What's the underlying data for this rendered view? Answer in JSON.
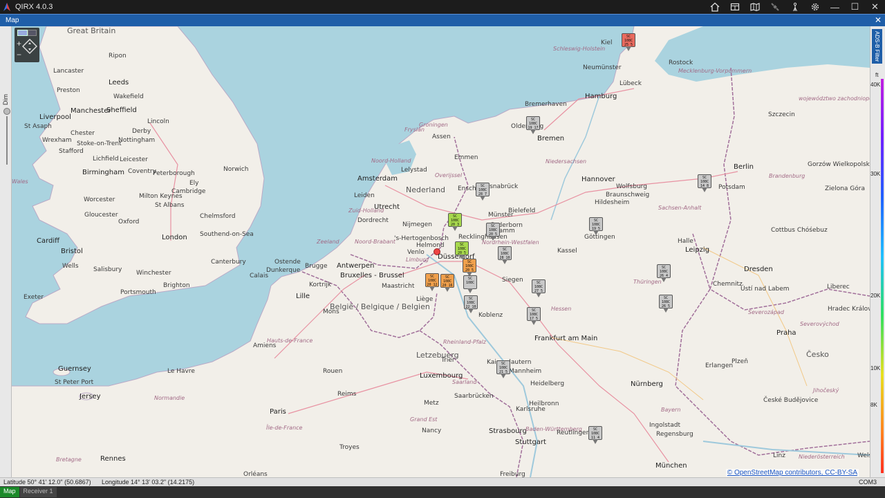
{
  "app": {
    "title": "QIRX 4.0.3",
    "titlebar_icons": [
      "home-icon",
      "layout-icon",
      "book-icon",
      "satellite-icon",
      "antenna-icon",
      "gear-icon"
    ],
    "window_controls": {
      "minimize": "—",
      "maximize": "☐",
      "close": "✕"
    }
  },
  "panel": {
    "title": "Map",
    "close": "✕"
  },
  "left_bar": {
    "label": "Dim"
  },
  "right_bar": {
    "filter_tab": "ADS-B Filter",
    "unit": "ft",
    "ticks": [
      "40K",
      "30K",
      "20K",
      "10K",
      "8K"
    ]
  },
  "map": {
    "labels": [
      {
        "t": "Great Britain",
        "c": "country"
      },
      {
        "t": "Ripon"
      },
      {
        "t": "Leeds",
        "c": "big"
      },
      {
        "t": "Lancaster"
      },
      {
        "t": "Preston"
      },
      {
        "t": "Wakefield"
      },
      {
        "t": "Manchester",
        "c": "big"
      },
      {
        "t": "Sheffield",
        "c": "big"
      },
      {
        "t": "Liverpool",
        "c": "big"
      },
      {
        "t": "St Asaph"
      },
      {
        "t": "Chester"
      },
      {
        "t": "Wrexham"
      },
      {
        "t": "Stoke-on-Trent"
      },
      {
        "t": "Derby"
      },
      {
        "t": "Nottingham"
      },
      {
        "t": "Lincoln"
      },
      {
        "t": "Stafford"
      },
      {
        "t": "Lichfield"
      },
      {
        "t": "Leicester"
      },
      {
        "t": "Birmingham",
        "c": "big"
      },
      {
        "t": "Coventry"
      },
      {
        "t": "Peterborough"
      },
      {
        "t": "Ely"
      },
      {
        "t": "Norwich"
      },
      {
        "t": "Cambridge"
      },
      {
        "t": "Worcester"
      },
      {
        "t": "Milton Keynes"
      },
      {
        "t": "Gloucester"
      },
      {
        "t": "Oxford"
      },
      {
        "t": "St Albans"
      },
      {
        "t": "Chelmsford"
      },
      {
        "t": "Southend-on-Sea"
      },
      {
        "t": "London",
        "c": "big"
      },
      {
        "t": "Cardiff",
        "c": "big"
      },
      {
        "t": "Bristol",
        "c": "big"
      },
      {
        "t": "Wells"
      },
      {
        "t": "Salisbury"
      },
      {
        "t": "Winchester"
      },
      {
        "t": "Canterbury"
      },
      {
        "t": "Brighton"
      },
      {
        "t": "Portsmouth"
      },
      {
        "t": "Exeter"
      },
      {
        "t": "Wales",
        "c": "region"
      },
      {
        "t": "Guernsey",
        "c": "big"
      },
      {
        "t": "St Peter Port"
      },
      {
        "t": "Jersey",
        "c": "big"
      },
      {
        "t": "Kiel"
      },
      {
        "t": "Schleswig-Holstein",
        "c": "region"
      },
      {
        "t": "Neumünster"
      },
      {
        "t": "Rostock"
      },
      {
        "t": "Mecklenburg-Vorpommern",
        "c": "region"
      },
      {
        "t": "Lübeck"
      },
      {
        "t": "Hamburg",
        "c": "big"
      },
      {
        "t": "Bremerhaven"
      },
      {
        "t": "Oldenburg"
      },
      {
        "t": "Bremen",
        "c": "big"
      },
      {
        "t": "Szczecin"
      },
      {
        "t": "województwo zachodniopomorskie",
        "c": "region"
      },
      {
        "t": "Gorzów Wielkopolski"
      },
      {
        "t": "Berlin",
        "c": "big"
      },
      {
        "t": "Potsdam"
      },
      {
        "t": "Brandenburg",
        "c": "region"
      },
      {
        "t": "Zielona Góra"
      },
      {
        "t": "Hannover",
        "c": "big"
      },
      {
        "t": "Wolfsburg"
      },
      {
        "t": "Braunschweig"
      },
      {
        "t": "Hildesheim"
      },
      {
        "t": "Niedersachsen",
        "c": "region"
      },
      {
        "t": "Sachsen-Anhalt",
        "c": "region"
      },
      {
        "t": "Cottbus Chóśebuz"
      },
      {
        "t": "Groningen",
        "c": "region"
      },
      {
        "t": "Assen"
      },
      {
        "t": "Emmen"
      },
      {
        "t": "Fryslân",
        "c": "region"
      },
      {
        "t": "Noord-Holland",
        "c": "region"
      },
      {
        "t": "Lelystad"
      },
      {
        "t": "Amsterdam",
        "c": "big"
      },
      {
        "t": "Nederland",
        "c": "country"
      },
      {
        "t": "Overijssel",
        "c": "region"
      },
      {
        "t": "Enschede"
      },
      {
        "t": "Osnabrück"
      },
      {
        "t": "Leiden"
      },
      {
        "t": "Utrecht",
        "c": "big"
      },
      {
        "t": "Zuid-Holland",
        "c": "region"
      },
      {
        "t": "Dordrecht"
      },
      {
        "t": "Nijmegen"
      },
      {
        "t": "Münster"
      },
      {
        "t": "Bielefeld"
      },
      {
        "t": "Paderborn"
      },
      {
        "t": "Hamm"
      },
      {
        "t": "Göttingen"
      },
      {
        "t": "Halle"
      },
      {
        "t": "Leipzig",
        "c": "big"
      },
      {
        "t": "Zeeland",
        "c": "region"
      },
      {
        "t": "Noord-Brabant",
        "c": "region"
      },
      {
        "t": "'s-Hertogenbosch"
      },
      {
        "t": "Recklinghausen"
      },
      {
        "t": "Helmond"
      },
      {
        "t": "Venlo"
      },
      {
        "t": "Limburg",
        "c": "region"
      },
      {
        "t": "Nordrhein-Westfalen",
        "c": "region"
      },
      {
        "t": "Düsseldorf",
        "c": "big"
      },
      {
        "t": "Kassel"
      },
      {
        "t": "Dresden",
        "c": "big"
      },
      {
        "t": "Ostende"
      },
      {
        "t": "Brugge"
      },
      {
        "t": "Antwerpen",
        "c": "big"
      },
      {
        "t": "Bruxelles - Brussel",
        "c": "big"
      },
      {
        "t": "Dunkerque"
      },
      {
        "t": "Calais"
      },
      {
        "t": "Kortrijk"
      },
      {
        "t": "Maastricht"
      },
      {
        "t": "Liège"
      },
      {
        "t": "Siegen"
      },
      {
        "t": "Thüringen",
        "c": "region"
      },
      {
        "t": "Chemnitz"
      },
      {
        "t": "Ústí nad Labem"
      },
      {
        "t": "Liberec"
      },
      {
        "t": "Lille",
        "c": "big"
      },
      {
        "t": "België / Belgique / Belgien",
        "c": "country"
      },
      {
        "t": "Mons"
      },
      {
        "t": "Koblenz"
      },
      {
        "t": "Hessen",
        "c": "region"
      },
      {
        "t": "Severozápad",
        "c": "region"
      },
      {
        "t": "Hradec Králové"
      },
      {
        "t": "Severovýchod",
        "c": "region"
      },
      {
        "t": "Frankfurt am Main",
        "c": "big"
      },
      {
        "t": "Praha",
        "c": "big"
      },
      {
        "t": "Hauts-de-France",
        "c": "region"
      },
      {
        "t": "Amiens"
      },
      {
        "t": "Rheinland-Pfalz",
        "c": "region"
      },
      {
        "t": "Trier"
      },
      {
        "t": "Letzebuerg",
        "c": "country"
      },
      {
        "t": "Luxembourg",
        "c": "big"
      },
      {
        "t": "Erlangen"
      },
      {
        "t": "Plzeň"
      },
      {
        "t": "Česko",
        "c": "country"
      },
      {
        "t": "Le Havre"
      },
      {
        "t": "Rouen"
      },
      {
        "t": "Kaiserslautern"
      },
      {
        "t": "Mannheim"
      },
      {
        "t": "Heidelberg"
      },
      {
        "t": "Nürnberg",
        "c": "big"
      },
      {
        "t": "Saarland",
        "c": "region"
      },
      {
        "t": "Saarbrücken"
      },
      {
        "t": "Jihočeský",
        "c": "region"
      },
      {
        "t": "Normandie",
        "c": "region"
      },
      {
        "t": "Reims"
      },
      {
        "t": "Metz"
      },
      {
        "t": "Heilbronn"
      },
      {
        "t": "Karlsruhe"
      },
      {
        "t": "České Budějovice"
      },
      {
        "t": "Bayern",
        "c": "region"
      },
      {
        "t": "Paris",
        "c": "big"
      },
      {
        "t": "Grand Est",
        "c": "region"
      },
      {
        "t": "Ingolstadt"
      },
      {
        "t": "Île-de-France",
        "c": "region"
      },
      {
        "t": "Nancy"
      },
      {
        "t": "Strasbourg",
        "c": "big"
      },
      {
        "t": "Baden-Württemberg",
        "c": "region"
      },
      {
        "t": "Stuttgart",
        "c": "big"
      },
      {
        "t": "Reutlingen"
      },
      {
        "t": "Regensburg"
      },
      {
        "t": "Troyes"
      },
      {
        "t": "Linz"
      },
      {
        "t": "Niederösterreich",
        "c": "region"
      },
      {
        "t": "Rennes",
        "c": "big"
      },
      {
        "t": "Bretagne",
        "c": "region"
      },
      {
        "t": "Orléans"
      },
      {
        "t": "Freiburg"
      },
      {
        "t": "München",
        "c": "big"
      },
      {
        "t": "Wels"
      }
    ],
    "aircraft": [
      {
        "l1": "SC",
        "l2": "108C",
        "l3": "25 5",
        "color": "#e86a5e"
      },
      {
        "l1": "SC",
        "l2": "108C",
        "l3": "19 17",
        "color": "#c8c8c8"
      },
      {
        "l1": "SC",
        "l2": "108C",
        "l3": "14 8",
        "color": "#c8c8c8"
      },
      {
        "l1": "SC",
        "l2": "108C",
        "l3": "28 7",
        "color": "#c8c8c8"
      },
      {
        "l1": "SC",
        "l2": "108C",
        "l3": "20 3",
        "color": "#a8d94e"
      },
      {
        "l1": "SC",
        "l2": "108C",
        "l3": "20 5",
        "color": "#c8c8c8"
      },
      {
        "l1": "SC",
        "l2": "108C",
        "l3": "19 5",
        "color": "#c8c8c8"
      },
      {
        "l1": "SC",
        "l2": "108C",
        "l3": "20 5",
        "color": "#a8d94e"
      },
      {
        "l1": "SC",
        "l2": "108C",
        "l3": "28 10",
        "color": "#c8c8c8"
      },
      {
        "l1": "SC",
        "l2": "108C",
        "l3": "20 5",
        "color": "#f0a04c"
      },
      {
        "l1": "SC",
        "l2": "108C",
        "l3": "26 4",
        "color": "#c8c8c8"
      },
      {
        "l1": "SC",
        "l2": "108C",
        "l3": "20 12",
        "color": "#f0a04c"
      },
      {
        "l1": "SC",
        "l2": "108C",
        "l3": "20 16",
        "color": "#f0a04c"
      },
      {
        "l1": "SC",
        "l2": "108C",
        "l3": "",
        "color": "#c8c8c8"
      },
      {
        "l1": "SC",
        "l2": "108C",
        "l3": "27 5",
        "color": "#c8c8c8"
      },
      {
        "l1": "SC",
        "l2": "108C",
        "l3": "22 10",
        "color": "#c8c8c8"
      },
      {
        "l1": "SC",
        "l2": "108C",
        "l3": "26 5",
        "color": "#c8c8c8"
      },
      {
        "l1": "SC",
        "l2": "108C",
        "l3": "17 5",
        "color": "#c8c8c8"
      },
      {
        "l1": "SC",
        "l2": "108C",
        "l3": "21 5",
        "color": "#c8c8c8"
      },
      {
        "l1": "SC",
        "l2": "108C",
        "l3": "11 4",
        "color": "#c8c8c8"
      }
    ],
    "attribution": "© OpenStreetMap contributors, CC-BY-SA"
  },
  "status": {
    "latitude": "Latitude 50° 41' 12.0\" (50.6867)",
    "longitude": "Longitude 14° 13' 03.2\" (14.2175)",
    "port": "COM3"
  },
  "tabs": [
    {
      "label": "Map",
      "active": true
    },
    {
      "label": "Receiver 1",
      "active": false
    }
  ]
}
